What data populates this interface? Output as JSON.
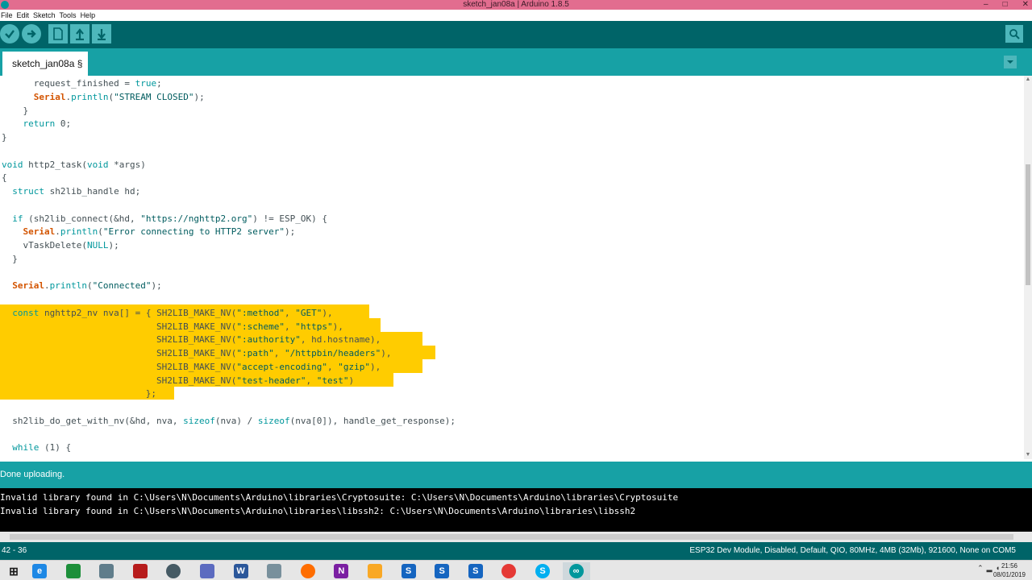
{
  "window": {
    "title": "sketch_jan08a | Arduino 1.8.5",
    "controls": [
      "–",
      "□",
      "✕"
    ]
  },
  "menu": [
    "File",
    "Edit",
    "Sketch",
    "Tools",
    "Help"
  ],
  "toolbar": {
    "buttons": [
      {
        "name": "verify",
        "icon": "check-icon"
      },
      {
        "name": "upload",
        "icon": "arrow-right-icon"
      },
      {
        "name": "new",
        "icon": "new-file-icon"
      },
      {
        "name": "open",
        "icon": "arrow-up-icon"
      },
      {
        "name": "save",
        "icon": "arrow-down-icon"
      }
    ],
    "serial_monitor_icon": "magnifier-icon"
  },
  "tabs": [
    {
      "label": "sketch_jan08a §"
    }
  ],
  "editor": {
    "cursor_position": "42 - 36",
    "lines": [
      "      request_finished = true;",
      "      Serial.println(\"STREAM CLOSED\");",
      "    }",
      "    return 0;",
      "}",
      "",
      "void http2_task(void *args)",
      "{",
      "  struct sh2lib_handle hd;",
      "",
      "  if (sh2lib_connect(&hd, \"https://nghttp2.org\") != ESP_OK) {",
      "    Serial.println(\"Error connecting to HTTP2 server\");",
      "    vTaskDelete(NULL);",
      "  }",
      "",
      "  Serial.println(\"Connected\");",
      "",
      "  const nghttp2_nv nva[] = { SH2LIB_MAKE_NV(\":method\", \"GET\"),",
      "                             SH2LIB_MAKE_NV(\":scheme\", \"https\"),",
      "                             SH2LIB_MAKE_NV(\":authority\", hd.hostname),",
      "                             SH2LIB_MAKE_NV(\":path\", \"/httpbin/headers\"),",
      "                             SH2LIB_MAKE_NV(\"accept-encoding\", \"gzip\"),",
      "                             SH2LIB_MAKE_NV(\"test-header\", \"test\")",
      "                           };",
      "",
      "  sh2lib_do_get_with_nv(&hd, nva, sizeof(nva) / sizeof(nva[0]), handle_get_response);",
      "",
      "  while (1) {"
    ]
  },
  "status": {
    "message": "Done uploading."
  },
  "console": {
    "lines": [
      "Invalid library found in C:\\Users\\N\\Documents\\Arduino\\libraries\\Cryptosuite: C:\\Users\\N\\Documents\\Arduino\\libraries\\Cryptosuite",
      "Invalid library found in C:\\Users\\N\\Documents\\Arduino\\libraries\\libssh2: C:\\Users\\N\\Documents\\Arduino\\libraries\\libssh2"
    ]
  },
  "infobar": {
    "position": "42 - 36",
    "board": "ESP32 Dev Module, Disabled, Default, QIO, 80MHz, 4MB (32Mb), 921600, None on COM5"
  },
  "taskbar": {
    "apps": [
      {
        "name": "start",
        "icon": "windows-icon",
        "glyph": "",
        "color": "#0078d7"
      },
      {
        "name": "edge",
        "icon": "ie-icon",
        "glyph": "e",
        "color": "#1e88e5"
      },
      {
        "name": "excel",
        "icon": "excel-icon",
        "glyph": "",
        "color": "#1d8f3a"
      },
      {
        "name": "monitor",
        "icon": "monitor-icon",
        "glyph": "",
        "color": "#607d8b"
      },
      {
        "name": "acrobat",
        "icon": "acrobat-icon",
        "glyph": "",
        "color": "#b71c1c"
      },
      {
        "name": "media",
        "icon": "disc-icon",
        "glyph": "",
        "color": "#455a64"
      },
      {
        "name": "display",
        "icon": "display-icon",
        "glyph": "",
        "color": "#5c6bc0"
      },
      {
        "name": "word",
        "icon": "word-icon",
        "glyph": "W",
        "color": "#2b579a"
      },
      {
        "name": "notepad",
        "icon": "document-icon",
        "glyph": "",
        "color": "#78909c"
      },
      {
        "name": "firefox",
        "icon": "firefox-icon",
        "glyph": "",
        "color": "#ff6d00"
      },
      {
        "name": "onenote",
        "icon": "onenote-icon",
        "glyph": "N",
        "color": "#7b1fa2"
      },
      {
        "name": "explorer",
        "icon": "folder-icon",
        "glyph": "",
        "color": "#f9a825"
      },
      {
        "name": "app-s1",
        "icon": "s-app-icon",
        "glyph": "S",
        "color": "#1565c0"
      },
      {
        "name": "app-s2",
        "icon": "s-app-icon",
        "glyph": "S",
        "color": "#1565c0"
      },
      {
        "name": "app-s3",
        "icon": "s-app-icon",
        "glyph": "S",
        "color": "#1565c0"
      },
      {
        "name": "chrome",
        "icon": "chrome-icon",
        "glyph": "",
        "color": "#e53935"
      },
      {
        "name": "skype",
        "icon": "skype-icon",
        "glyph": "S",
        "color": "#00aff0"
      },
      {
        "name": "arduino",
        "icon": "arduino-icon",
        "glyph": "∞",
        "color": "#00979c"
      }
    ],
    "clock": {
      "time": "21:56",
      "date": "08/01/2019"
    }
  },
  "colors": {
    "title_bar": "#e26d8f",
    "toolbar": "#006468",
    "tab_bar": "#17a1a5",
    "selection": "#ffcc00"
  }
}
